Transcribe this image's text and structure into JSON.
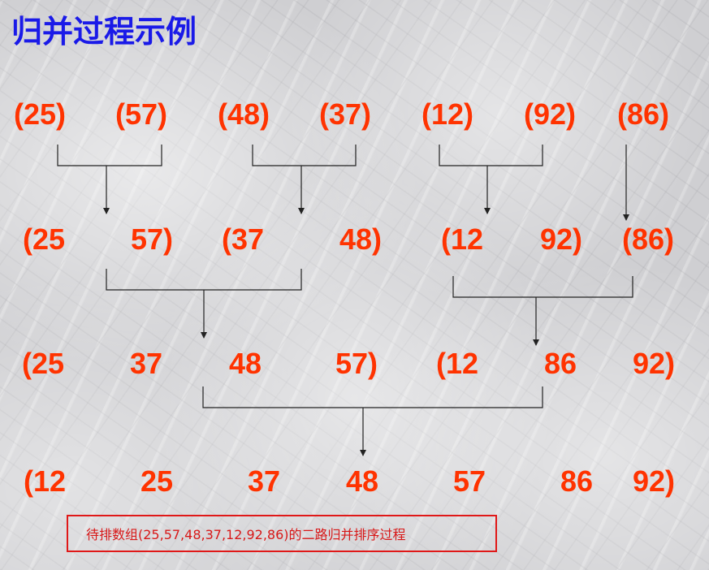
{
  "title": "归并过程示例",
  "rows": [
    [
      "(25)",
      "(57)",
      "(48)",
      "(37)",
      "(12)",
      "(92)",
      "(86)"
    ],
    [
      "(25",
      "57)",
      "(37",
      "48)",
      "(12",
      "92)",
      "(86)"
    ],
    [
      "(25",
      "37",
      "48",
      "57)",
      "(12",
      "86",
      "92)"
    ],
    [
      "(12",
      "25",
      "37",
      "48",
      "57",
      "86",
      "92)"
    ]
  ],
  "caption": "待排数组(25,57,48,37,12,92,86)的二路归并排序过程",
  "colors": {
    "title": "#1a1ae8",
    "numbers": "#ff3300",
    "caption": "#d81818",
    "lines": "#222222"
  }
}
